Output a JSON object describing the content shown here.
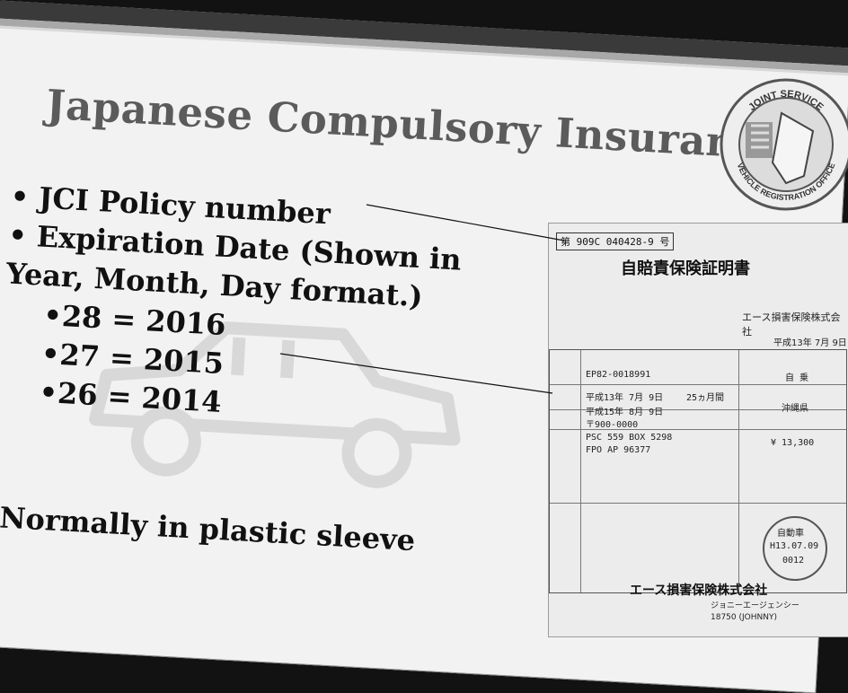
{
  "slide": {
    "title": "Japanese Compulsory Insurance",
    "bullets": [
      "• JCI Policy number",
      "• Expiration Date (Shown in",
      "Year, Month, Day format.)"
    ],
    "sub_bullets": [
      "•28 = 2016",
      "•27 = 2015",
      "•26 = 2014"
    ],
    "last_bullet": "• Normally in plastic sleeve"
  },
  "seal": {
    "top_text": "JOINT SERVICE",
    "bottom_text": "VEHICLE REGISTRATION OFFICE"
  },
  "certificate": {
    "policy_number": "第 909C 040428-9 号",
    "heading": "自賠責保険証明書",
    "company_header": "エース損害保険株式会社",
    "issue_date": "平成13年 7月 9日",
    "serial": "EP82-0018991",
    "period_from": "平成13年 7月 9日",
    "period_to": "平成15年 8月 9日",
    "period_months": "25ヵ月間",
    "usage": "自 乗",
    "location": "沖縄県",
    "postal": "〒900-0000",
    "address_1": "PSC 559 BOX 5298",
    "address_2": "FPO AP 96377",
    "premium": "¥ 13,300",
    "stamp_label": "自動車",
    "stamp_date": "H13.07.09",
    "stamp_no": "0012",
    "company_footer": "エース損害保険株式会社",
    "agent": "ジョニーエージェンシー",
    "agent_code": "18750 (JOHNNY)"
  }
}
